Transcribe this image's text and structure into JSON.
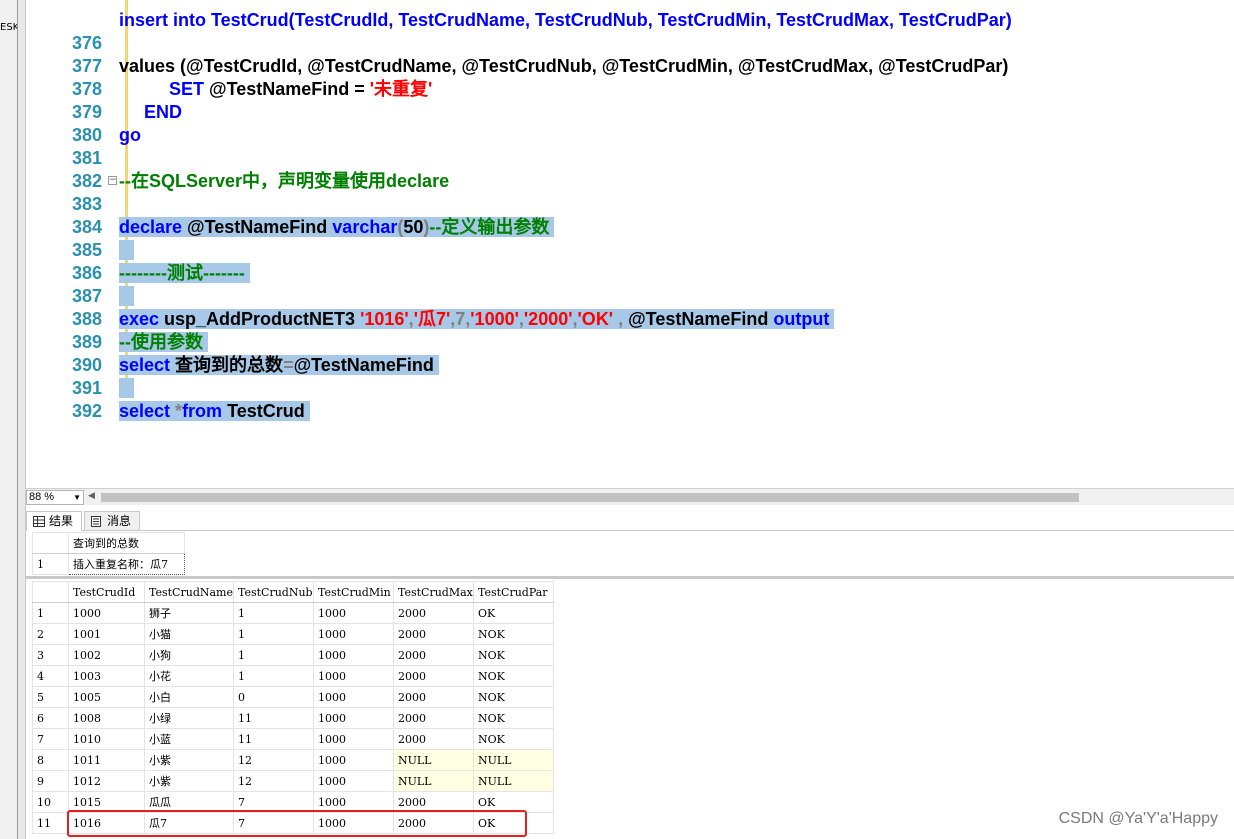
{
  "left_strip_text": "ESK",
  "code_lines": [
    {
      "n": "376",
      "segs": [
        {
          "t": "values (",
          "c": "kw-mix"
        }
      ]
    },
    {
      "n": "377"
    },
    {
      "n": "378"
    },
    {
      "n": "379"
    },
    {
      "n": "380"
    },
    {
      "n": "381"
    },
    {
      "n": "382"
    },
    {
      "n": "383"
    },
    {
      "n": "384"
    },
    {
      "n": "385"
    },
    {
      "n": "386"
    },
    {
      "n": "387"
    },
    {
      "n": "388"
    },
    {
      "n": "389"
    },
    {
      "n": "390"
    },
    {
      "n": "391"
    },
    {
      "n": "392"
    }
  ],
  "code": {
    "l376": "values (@TestCrudId, @TestCrudName, @TestCrudNub, @TestCrudMin, @TestCrudMax, @TestCrudPar)",
    "l377_kw": "SET",
    "l377_var": " @TestNameFind = ",
    "l377_str": "'未重复'",
    "l378": "END",
    "l379": "go",
    "l381": "--在SQLServer中，声明变量使用declare",
    "l383_kw1": "declare",
    "l383_var": " @TestNameFind ",
    "l383_kw2": "varchar",
    "l383_p1": "(",
    "l383_num": "50",
    "l383_p2": ")",
    "l383_cm": "--定义输出参数",
    "l385": "--------测试-------",
    "l387_kw": "exec",
    "l387_proc": " usp_AddProductNET3 ",
    "l387_s1": "'1016'",
    "l387_c1": ",",
    "l387_s2": "'瓜7'",
    "l387_c2": ",7,",
    "l387_s3": "'1000'",
    "l387_c3": ",",
    "l387_s4": "'2000'",
    "l387_c4": ",",
    "l387_s5": "'OK'",
    "l387_c5": " , ",
    "l387_var": "@TestNameFind ",
    "l387_kw2": "output",
    "l388": "--使用参数",
    "l389_kw": "select",
    "l389_rest": " 查询到的总数",
    "l389_eq": "=",
    "l389_var": "@TestNameFind",
    "l391_kw": "select",
    "l391_star": " *",
    "l391_kw2": "from",
    "l391_tbl": " TestCrud",
    "top_partial": "insert into TestCrud(TestCrudId, TestCrudName, TestCrudNub, TestCrudMin, TestCrudMax, TestCrudPar)"
  },
  "line_numbers": [
    "376",
    "377",
    "378",
    "379",
    "380",
    "381",
    "382",
    "383",
    "384",
    "385",
    "386",
    "387",
    "388",
    "389",
    "390",
    "391",
    "392"
  ],
  "zoom": "88 %",
  "tabs": {
    "results": "结果",
    "messages": "消息"
  },
  "grid1": {
    "header": "查询到的总数",
    "row_num": "1",
    "value": "插入重复名称：瓜7"
  },
  "grid2": {
    "columns": [
      "TestCrudId",
      "TestCrudName",
      "TestCrudNub",
      "TestCrudMin",
      "TestCrudMax",
      "TestCrudPar"
    ],
    "rows": [
      [
        "1",
        "1000",
        "狮子",
        "1",
        "1000",
        "2000",
        "OK"
      ],
      [
        "2",
        "1001",
        "小猫",
        "1",
        "1000",
        "2000",
        "NOK"
      ],
      [
        "3",
        "1002",
        "小狗",
        "1",
        "1000",
        "2000",
        "NOK"
      ],
      [
        "4",
        "1003",
        "小花",
        "1",
        "1000",
        "2000",
        "NOK"
      ],
      [
        "5",
        "1005",
        "小白",
        "0",
        "1000",
        "2000",
        "NOK"
      ],
      [
        "6",
        "1008",
        "小绿",
        "11",
        "1000",
        "2000",
        "NOK"
      ],
      [
        "7",
        "1010",
        "小蓝",
        "11",
        "1000",
        "2000",
        "NOK"
      ],
      [
        "8",
        "1011",
        "小紫",
        "12",
        "1000",
        "NULL",
        "NULL"
      ],
      [
        "9",
        "1012",
        "小紫",
        "12",
        "1000",
        "NULL",
        "NULL"
      ],
      [
        "10",
        "1015",
        "瓜瓜",
        "7",
        "1000",
        "2000",
        "OK"
      ],
      [
        "11",
        "1016",
        "瓜7",
        "7",
        "1000",
        "2000",
        "OK"
      ]
    ]
  },
  "watermark": "CSDN @Ya'Y'a'Happy",
  "colors": {
    "keyword": "#0000ff",
    "string": "#ff0000",
    "comment": "#008000",
    "line_number": "#2b91af",
    "selection": "#a7c8e6",
    "highlight_box": "#e12020"
  }
}
